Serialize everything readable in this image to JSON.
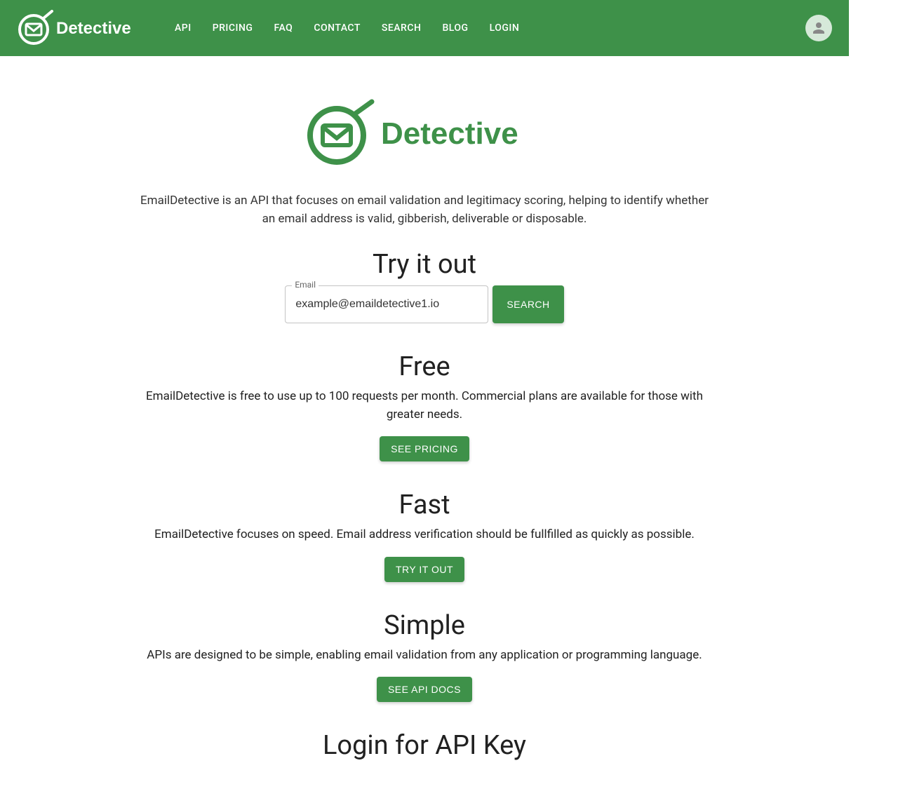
{
  "brand": "Detective",
  "nav": {
    "items": [
      {
        "label": "API"
      },
      {
        "label": "PRICING"
      },
      {
        "label": "FAQ"
      },
      {
        "label": "CONTACT"
      },
      {
        "label": "SEARCH"
      },
      {
        "label": "BLOG"
      },
      {
        "label": "LOGIN"
      }
    ]
  },
  "hero": {
    "description": "EmailDetective is an API that focuses on email validation and legitimacy scoring, helping to identify whether an email address is valid, gibberish, deliverable or disposable."
  },
  "try": {
    "title": "Try it out",
    "email_label": "Email",
    "email_value": "example@emaildetective1.io",
    "search_button": "SEARCH"
  },
  "features": [
    {
      "title": "Free",
      "description": "EmailDetective is free to use up to 100 requests per month. Commercial plans are available for those with greater needs.",
      "button": "SEE PRICING"
    },
    {
      "title": "Fast",
      "description": "EmailDetective focuses on speed. Email address verification should be fullfilled as quickly as possible.",
      "button": "TRY IT OUT"
    },
    {
      "title": "Simple",
      "description": "APIs are designed to be simple, enabling email validation from any application or programming language.",
      "button": "SEE API DOCS"
    }
  ],
  "login_section": {
    "title": "Login for API Key"
  },
  "colors": {
    "primary": "#3e9149"
  }
}
